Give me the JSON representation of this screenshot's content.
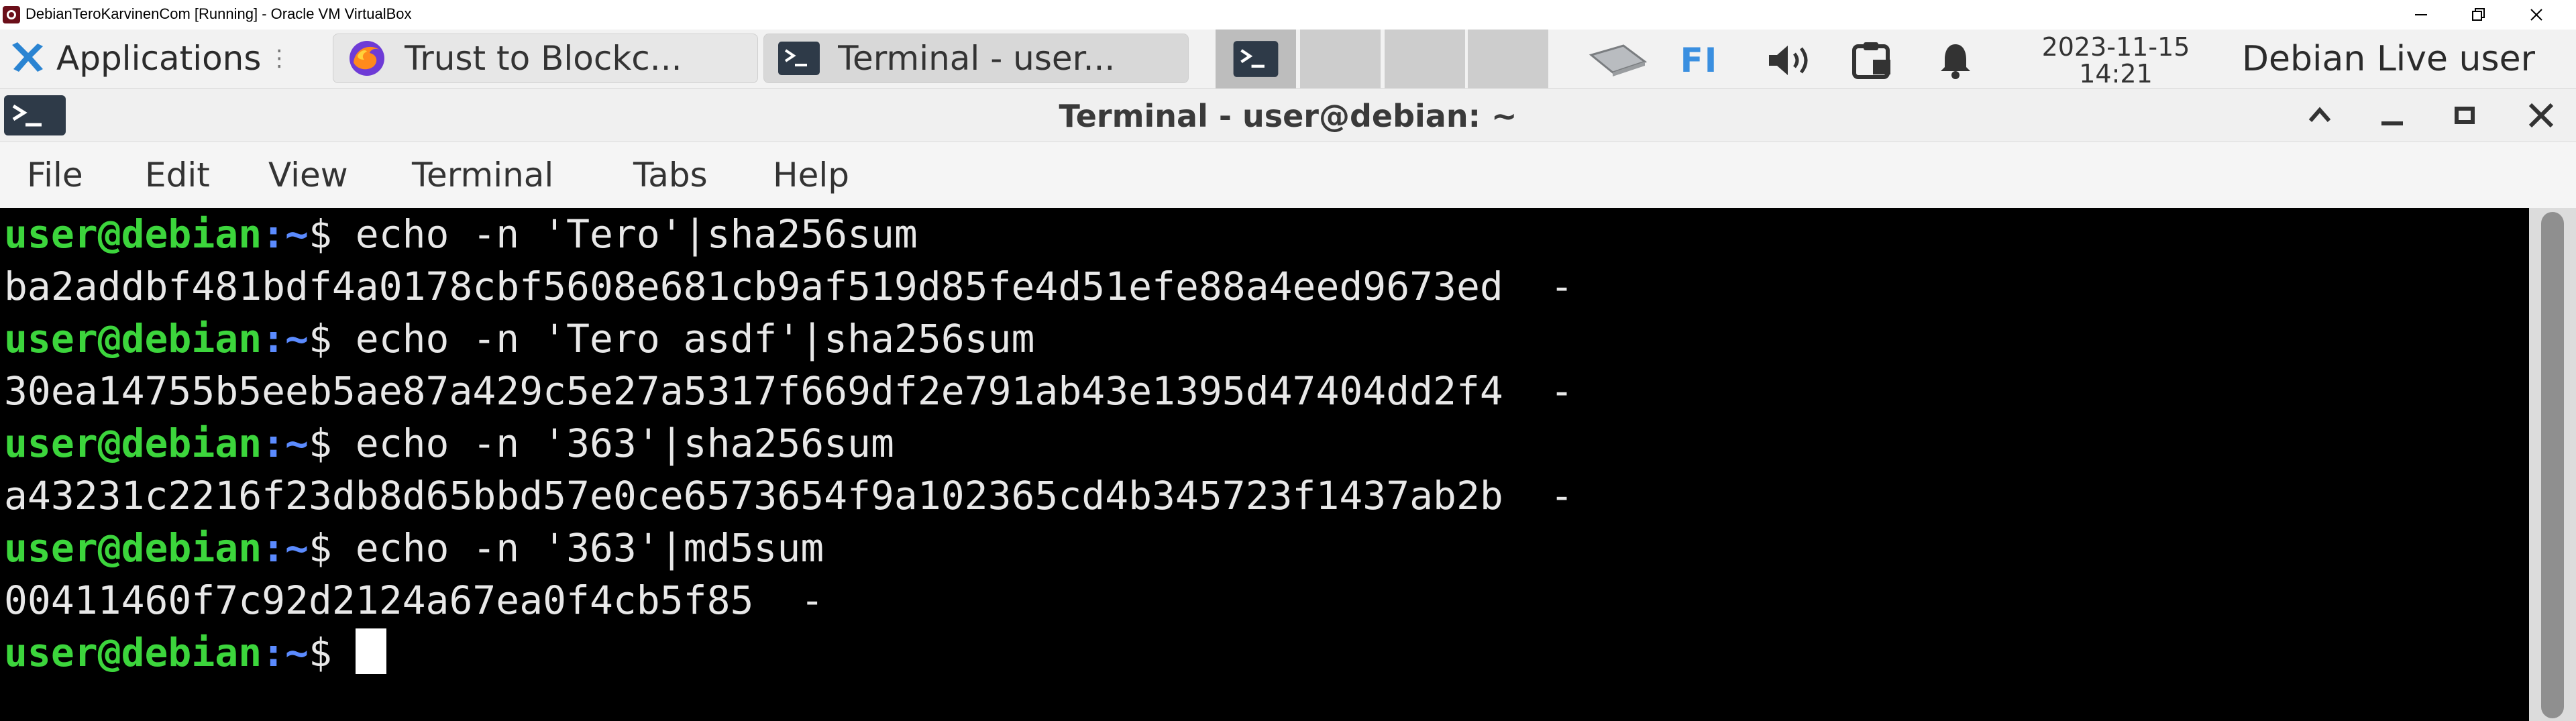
{
  "host_window": {
    "title": "DebianTeroKarvinenCom [Running] - Oracle VM VirtualBox",
    "controls": [
      "minimize",
      "restore",
      "close"
    ]
  },
  "panel": {
    "applications_label": "Applications",
    "tasks": [
      {
        "label": "Trust to Blockc...",
        "icon": "firefox-icon"
      },
      {
        "label": "Terminal - user...",
        "icon": "terminal-icon"
      }
    ],
    "workspaces": [
      "1",
      "2",
      "3",
      "4"
    ],
    "keyboard_layout": "FI",
    "clock_date": "2023-11-15",
    "clock_time": "14:21",
    "user": "Debian Live user"
  },
  "terminal": {
    "window_title": "Terminal - user@debian: ~",
    "menu": [
      "File",
      "Edit",
      "View",
      "Terminal",
      "Tabs",
      "Help"
    ],
    "prompt_user": "user@debian",
    "prompt_path": ":~",
    "prompt_sign": "$ ",
    "lines": [
      {
        "type": "command",
        "text": "echo -n 'Tero'|sha256sum"
      },
      {
        "type": "output",
        "text": "ba2addbf481bdf4a0178cbf5608e681cb9af519d85fe4d51efe88a4eed9673ed  -"
      },
      {
        "type": "command",
        "text": "echo -n 'Tero asdf'|sha256sum"
      },
      {
        "type": "output",
        "text": "30ea14755b5eeb5ae87a429c5e27a5317f669df2e791ab43e1395d47404dd2f4  -"
      },
      {
        "type": "command",
        "text": "echo -n '363'|sha256sum"
      },
      {
        "type": "output",
        "text": "a43231c2216f23db8d65bbd57e0ce6573654f9a102365cd4b345723f1437ab2b  -"
      },
      {
        "type": "command",
        "text": "echo -n '363'|md5sum"
      },
      {
        "type": "output",
        "text": "00411460f7c92d2124a67ea0f4cb5f85  -"
      },
      {
        "type": "command",
        "text": ""
      }
    ]
  },
  "colors": {
    "prompt_user": "#3cd53c",
    "prompt_path": "#5b8bff",
    "terminal_bg": "#000000",
    "terminal_fg": "#e8e8e8",
    "keyboard_layout": "#3a8fe0"
  }
}
